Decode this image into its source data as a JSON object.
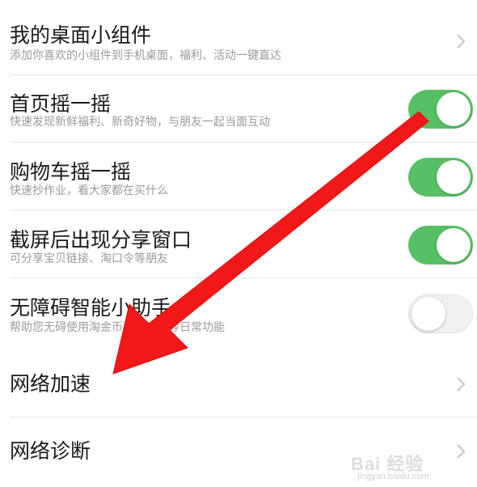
{
  "settings": {
    "items": [
      {
        "title": "我的桌面小组件",
        "subtitle": "添加你喜欢的小组件到手机桌面，福利、活动一键直达",
        "control": "chevron"
      },
      {
        "title": "首页摇一摇",
        "subtitle": "快速发现新鲜福利、新奇好物，与朋友一起当面互动",
        "control": "toggle",
        "enabled": true
      },
      {
        "title": "购物车摇一摇",
        "subtitle": "快速抄作业，看大家都在买什么",
        "control": "toggle",
        "enabled": true
      },
      {
        "title": "截屏后出现分享窗口",
        "subtitle": "可分享宝贝链接、淘口令等朋友",
        "control": "toggle",
        "enabled": true
      },
      {
        "title": "无障碍智能小助手",
        "subtitle": "帮助您无碍使用淘金币、充流量等日常功能",
        "control": "toggle",
        "enabled": false
      },
      {
        "title": "网络加速",
        "control": "chevron"
      },
      {
        "title": "网络诊断",
        "control": "chevron"
      }
    ]
  },
  "colors": {
    "toggle_on": "#58c064",
    "toggle_off": "#f0f0f0",
    "annotation_arrow": "#f01818"
  },
  "watermark": {
    "brand": "Bai 经验",
    "url": "jingyan.baidu.com"
  }
}
